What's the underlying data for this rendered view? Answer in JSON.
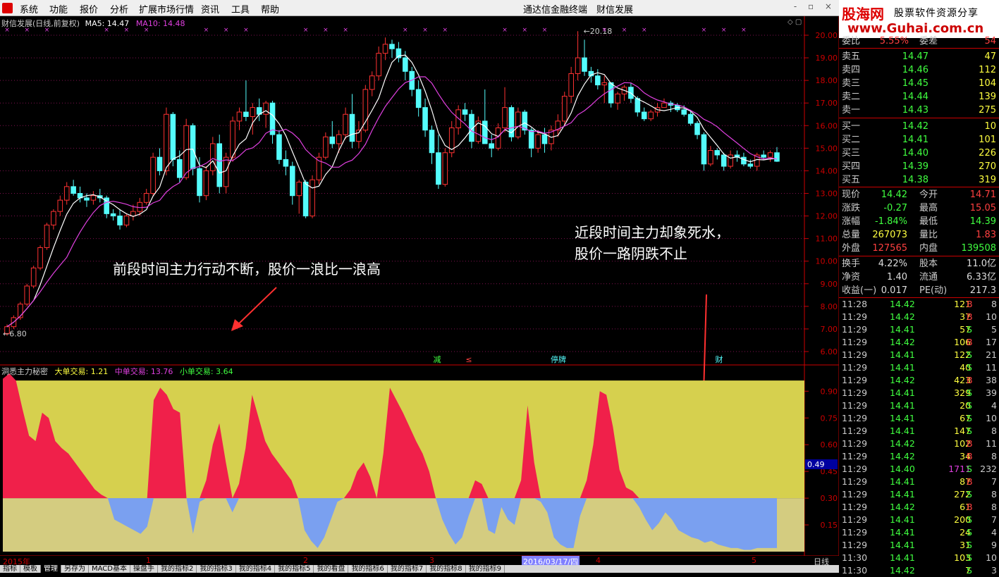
{
  "menu": {
    "items": [
      "系统",
      "功能",
      "报价",
      "分析",
      "扩展市场行情",
      "资讯",
      "工具",
      "帮助"
    ],
    "center": "通达信金融终端　财信发展",
    "controls": "- ▫ ×"
  },
  "brand": {
    "name": "股海网",
    "slogan": "股票软件资源分享",
    "url": "www.Guhai.com.cn"
  },
  "chart_info": {
    "title": "财信发展(日线,前复权)",
    "ma5": "MA5: 14.47",
    "ma10": "MA10: 14.48"
  },
  "toggles": "◇ ▢",
  "annotations": {
    "left": "前段时间主力行动不断，股价一浪比一浪高",
    "right_line1": "近段时间主力却象死水，",
    "right_line2": "股价一路阴跌不止"
  },
  "price_axis": [
    "20.00",
    "19.00",
    "18.00",
    "17.00",
    "16.00",
    "15.00",
    "14.00",
    "13.00",
    "12.00",
    "11.00",
    "10.00",
    "9.00",
    "8.00",
    "7.00",
    "6.00"
  ],
  "price_labels": {
    "high": "20.18",
    "low": "6.80"
  },
  "events": [
    "减",
    "≤",
    "停牌",
    "财"
  ],
  "indicator": {
    "name": "洞悉主力秘密",
    "big": "大单交易: 1.21",
    "mid": "中单交易: 13.76",
    "small": "小单交易: 3.64",
    "axis": [
      "0.90",
      "0.75",
      "0.60",
      "0.45",
      "0.30",
      "0.15"
    ],
    "cursor_value": "0.49"
  },
  "date_axis": {
    "start": "2015年",
    "m1": "1",
    "m2": "2",
    "m3": "3",
    "current": "2016/03/17/四",
    "m4": "4",
    "m5": "5"
  },
  "period_label": "日线",
  "tabs": [
    "指标",
    "模板",
    "管理",
    "另存为",
    "MACD基本",
    "操盘手",
    "我的指标2",
    "我的指标3",
    "我的指标4",
    "我的指标5",
    "我的看盘",
    "我的指标6",
    "我的指标7",
    "我的指标8",
    "我的指标9"
  ],
  "quote": {
    "top": {
      "label": "委比",
      "pct": "5.55%",
      "label2": "委差",
      "val": "54"
    },
    "asks": [
      {
        "label": "卖五",
        "price": "14.47",
        "vol": "47"
      },
      {
        "label": "卖四",
        "price": "14.46",
        "vol": "112"
      },
      {
        "label": "卖三",
        "price": "14.45",
        "vol": "104"
      },
      {
        "label": "卖二",
        "price": "14.44",
        "vol": "139"
      },
      {
        "label": "卖一",
        "price": "14.43",
        "vol": "275"
      }
    ],
    "bids": [
      {
        "label": "买一",
        "price": "14.42",
        "vol": "10"
      },
      {
        "label": "买二",
        "price": "14.41",
        "vol": "101"
      },
      {
        "label": "买三",
        "price": "14.40",
        "vol": "226"
      },
      {
        "label": "买四",
        "price": "14.39",
        "vol": "270"
      },
      {
        "label": "买五",
        "price": "14.38",
        "vol": "319"
      }
    ],
    "stats1": [
      {
        "l": "现价",
        "v": "14.42",
        "l2": "今开",
        "v2": "14.71"
      },
      {
        "l": "涨跌",
        "v": "-0.27",
        "l2": "最高",
        "v2": "15.05"
      },
      {
        "l": "涨幅",
        "v": "-1.84%",
        "l2": "最低",
        "v2": "14.39"
      },
      {
        "l": "总量",
        "v": "267073",
        "l2": "量比",
        "v2": "1.83"
      },
      {
        "l": "外盘",
        "v": "127565",
        "l2": "内盘",
        "v2": "139508"
      }
    ],
    "stats2": [
      {
        "l": "换手",
        "v": "4.22%",
        "l2": "股本",
        "v2": "11.0亿"
      },
      {
        "l": "净资",
        "v": "1.40",
        "l2": "流通",
        "v2": "6.33亿"
      },
      {
        "l": "收益(一)",
        "v": "0.017",
        "l2": "PE(动)",
        "v2": "217.3"
      }
    ],
    "ticks": [
      [
        "11:28",
        "14.42",
        "121",
        "B",
        "8"
      ],
      [
        "11:29",
        "14.42",
        "37",
        "B",
        "10"
      ],
      [
        "11:29",
        "14.41",
        "57",
        "S",
        "5"
      ],
      [
        "11:29",
        "14.42",
        "106",
        "B",
        "17"
      ],
      [
        "11:29",
        "14.41",
        "122",
        "S",
        "21"
      ],
      [
        "11:29",
        "14.41",
        "40",
        "S",
        "11"
      ],
      [
        "11:29",
        "14.42",
        "423",
        "B",
        "38"
      ],
      [
        "11:29",
        "14.41",
        "329",
        "S",
        "39"
      ],
      [
        "11:29",
        "14.41",
        "20",
        "S",
        "4"
      ],
      [
        "11:29",
        "14.41",
        "67",
        "S",
        "10"
      ],
      [
        "11:29",
        "14.41",
        "147",
        "S",
        "8"
      ],
      [
        "11:29",
        "14.42",
        "102",
        "B",
        "11"
      ],
      [
        "11:29",
        "14.42",
        "34",
        "B",
        "8"
      ],
      [
        "11:29",
        "14.40",
        "1711",
        "S",
        "232"
      ],
      [
        "11:29",
        "14.41",
        "87",
        "B",
        "7"
      ],
      [
        "11:29",
        "14.41",
        "272",
        "S",
        "8"
      ],
      [
        "11:29",
        "14.42",
        "61",
        "B",
        "8"
      ],
      [
        "11:29",
        "14.41",
        "200",
        "S",
        "7"
      ],
      [
        "11:29",
        "14.41",
        "24",
        "S",
        "4"
      ],
      [
        "11:29",
        "14.41",
        "31",
        "S",
        "9"
      ],
      [
        "11:30",
        "14.41",
        "103",
        "S",
        "10"
      ],
      [
        "11:30",
        "14.42",
        "7",
        "S",
        "3"
      ]
    ]
  },
  "chart_data": {
    "type": "candlestick",
    "title": "财信发展(日线,前复权)",
    "ylim": [
      6.0,
      20.5
    ],
    "ma_series": [
      {
        "name": "MA5"
      },
      {
        "name": "MA10"
      }
    ],
    "ohlc": [
      [
        6.8,
        7.2,
        6.7,
        7.1
      ],
      [
        7.1,
        7.6,
        7.0,
        7.5
      ],
      [
        7.5,
        8.2,
        7.4,
        8.1
      ],
      [
        8.1,
        9.0,
        8.0,
        8.9
      ],
      [
        8.9,
        9.8,
        8.8,
        9.7
      ],
      [
        9.7,
        10.7,
        9.6,
        10.6
      ],
      [
        10.6,
        11.7,
        10.5,
        11.6
      ],
      [
        11.6,
        12.3,
        11.4,
        12.2
      ],
      [
        12.2,
        12.9,
        12.0,
        12.7
      ],
      [
        12.7,
        13.5,
        12.5,
        13.3
      ],
      [
        13.3,
        13.6,
        12.9,
        13.0
      ],
      [
        13.0,
        13.3,
        12.6,
        12.8
      ],
      [
        12.8,
        13.0,
        12.4,
        12.7
      ],
      [
        12.7,
        13.1,
        12.5,
        12.9
      ],
      [
        12.9,
        13.2,
        12.6,
        12.8
      ],
      [
        12.8,
        12.9,
        11.9,
        12.1
      ],
      [
        12.1,
        12.3,
        11.8,
        12.0
      ],
      [
        12.0,
        12.3,
        11.4,
        11.6
      ],
      [
        11.6,
        12.1,
        11.5,
        12.0
      ],
      [
        12.0,
        12.5,
        11.8,
        12.2
      ],
      [
        12.2,
        12.8,
        12.0,
        12.6
      ],
      [
        12.6,
        13.2,
        12.5,
        13.0
      ],
      [
        13.0,
        14.8,
        12.9,
        14.6
      ],
      [
        14.6,
        15.0,
        13.8,
        14.0
      ],
      [
        14.0,
        16.8,
        13.8,
        16.5
      ],
      [
        16.5,
        16.6,
        14.2,
        14.5
      ],
      [
        14.5,
        14.9,
        13.5,
        13.7
      ],
      [
        13.7,
        16.3,
        13.6,
        16.0
      ],
      [
        16.0,
        16.1,
        13.8,
        14.1
      ],
      [
        14.1,
        14.6,
        12.6,
        12.9
      ],
      [
        12.9,
        14.2,
        12.7,
        14.0
      ],
      [
        14.0,
        15.5,
        13.8,
        15.2
      ],
      [
        15.2,
        15.6,
        13.0,
        13.3
      ],
      [
        13.3,
        14.8,
        13.0,
        14.6
      ],
      [
        14.6,
        16.4,
        14.4,
        16.2
      ],
      [
        16.2,
        16.8,
        15.8,
        16.6
      ],
      [
        16.6,
        18.0,
        16.2,
        16.4
      ],
      [
        16.4,
        17.0,
        15.6,
        16.8
      ],
      [
        16.8,
        17.2,
        16.2,
        16.5
      ],
      [
        16.5,
        17.1,
        15.9,
        17.0
      ],
      [
        17.0,
        17.1,
        15.2,
        15.6
      ],
      [
        15.6,
        15.8,
        14.3,
        14.5
      ],
      [
        14.5,
        14.9,
        13.8,
        14.2
      ],
      [
        14.2,
        14.4,
        12.5,
        12.9
      ],
      [
        12.9,
        13.6,
        12.1,
        13.5
      ],
      [
        13.5,
        13.6,
        11.9,
        12.0
      ],
      [
        12.0,
        13.8,
        11.9,
        13.6
      ],
      [
        13.6,
        14.8,
        13.4,
        14.6
      ],
      [
        14.6,
        15.7,
        14.5,
        15.5
      ],
      [
        15.5,
        16.2,
        15.0,
        15.2
      ],
      [
        15.2,
        15.8,
        14.8,
        15.6
      ],
      [
        15.6,
        16.8,
        15.4,
        16.5
      ],
      [
        16.5,
        17.4,
        15.0,
        15.3
      ],
      [
        15.3,
        16.2,
        15.0,
        15.8
      ],
      [
        15.8,
        17.8,
        15.7,
        17.6
      ],
      [
        17.6,
        18.4,
        17.3,
        18.2
      ],
      [
        18.2,
        19.5,
        18.0,
        19.2
      ],
      [
        19.2,
        19.9,
        18.9,
        19.6
      ],
      [
        19.6,
        19.8,
        19.0,
        19.4
      ],
      [
        19.4,
        19.7,
        18.8,
        19.0
      ],
      [
        19.0,
        19.3,
        18.0,
        18.4
      ],
      [
        18.4,
        18.6,
        17.3,
        17.6
      ],
      [
        17.6,
        18.0,
        16.4,
        16.8
      ],
      [
        16.8,
        17.2,
        15.5,
        15.8
      ],
      [
        15.8,
        16.0,
        14.3,
        14.8
      ],
      [
        14.8,
        15.6,
        13.2,
        13.4
      ],
      [
        13.4,
        15.0,
        13.3,
        14.8
      ],
      [
        14.8,
        16.2,
        14.6,
        15.9
      ],
      [
        15.9,
        16.9,
        15.6,
        16.7
      ],
      [
        16.7,
        17.0,
        16.2,
        16.5
      ],
      [
        16.5,
        16.7,
        15.0,
        15.3
      ],
      [
        15.3,
        16.4,
        15.2,
        16.2
      ],
      [
        16.2,
        17.6,
        15.8,
        15.2
      ],
      [
        15.2,
        15.6,
        14.6,
        15.0
      ],
      [
        15.0,
        16.1,
        14.9,
        15.9
      ],
      [
        15.9,
        17.7,
        15.7,
        16.8
      ],
      [
        16.8,
        16.9,
        15.3,
        15.5
      ],
      [
        15.5,
        16.8,
        15.4,
        16.6
      ],
      [
        16.6,
        16.7,
        15.6,
        15.8
      ],
      [
        15.8,
        15.9,
        14.6,
        15.0
      ],
      [
        15.0,
        15.8,
        14.8,
        15.6
      ],
      [
        15.6,
        15.9,
        14.8,
        15.2
      ],
      [
        15.2,
        16.0,
        14.9,
        15.8
      ],
      [
        15.8,
        16.5,
        15.5,
        16.2
      ],
      [
        16.2,
        17.5,
        16.0,
        17.3
      ],
      [
        17.3,
        18.6,
        17.0,
        18.3
      ],
      [
        18.3,
        20.18,
        18.0,
        19.0
      ],
      [
        19.0,
        19.8,
        18.2,
        18.4
      ],
      [
        18.4,
        18.6,
        17.9,
        18.2
      ],
      [
        18.2,
        18.5,
        17.6,
        17.8
      ],
      [
        17.8,
        18.2,
        17.0,
        17.9
      ],
      [
        17.9,
        17.9,
        16.8,
        17.0
      ],
      [
        17.0,
        17.5,
        16.7,
        17.4
      ],
      [
        17.4,
        17.8,
        17.1,
        17.7
      ],
      [
        17.7,
        17.9,
        17.0,
        17.2
      ],
      [
        17.2,
        17.3,
        16.4,
        16.6
      ],
      [
        16.6,
        16.8,
        16.2,
        16.3
      ],
      [
        16.3,
        16.7,
        16.2,
        16.6
      ],
      [
        16.6,
        17.0,
        16.4,
        16.8
      ],
      [
        16.8,
        17.2,
        16.8,
        17.0
      ],
      [
        17.0,
        17.1,
        16.6,
        16.9
      ],
      [
        16.9,
        17.0,
        16.6,
        16.7
      ],
      [
        16.7,
        16.9,
        16.4,
        16.5
      ],
      [
        16.5,
        16.7,
        16.0,
        16.1
      ],
      [
        16.1,
        16.2,
        15.4,
        15.6
      ],
      [
        15.6,
        15.7,
        14.0,
        14.3
      ],
      [
        14.3,
        15.1,
        14.2,
        14.9
      ],
      [
        14.9,
        15.0,
        14.5,
        14.7
      ],
      [
        14.7,
        14.8,
        14.0,
        14.2
      ],
      [
        14.2,
        14.9,
        14.1,
        14.7
      ],
      [
        14.7,
        14.9,
        14.4,
        14.6
      ],
      [
        14.6,
        14.8,
        14.2,
        14.3
      ],
      [
        14.3,
        14.5,
        14.1,
        14.2
      ],
      [
        14.2,
        14.8,
        14.0,
        14.7
      ],
      [
        14.7,
        14.9,
        14.5,
        14.6
      ],
      [
        14.6,
        14.9,
        14.4,
        14.8
      ],
      [
        14.8,
        15.05,
        14.39,
        14.42
      ]
    ],
    "indicator_series": [
      0.97,
      1.0,
      0.96,
      0.8,
      0.65,
      0.62,
      0.78,
      0.75,
      0.62,
      0.58,
      0.55,
      0.5,
      0.45,
      0.4,
      0.35,
      0.32,
      0.3,
      0.18,
      0.16,
      0.14,
      0.12,
      0.1,
      0.14,
      0.85,
      0.92,
      0.88,
      0.8,
      0.78,
      0.3,
      0.1,
      0.28,
      0.4,
      0.6,
      0.72,
      0.5,
      0.22,
      0.38,
      0.58,
      0.88,
      0.75,
      0.62,
      0.55,
      0.5,
      0.45,
      0.4,
      0.3,
      0.12,
      0.06,
      0.02,
      0.08,
      0.18,
      0.28,
      0.3,
      0.35,
      0.45,
      0.5,
      0.42,
      0.3,
      0.55,
      0.92,
      0.85,
      0.78,
      0.7,
      0.62,
      0.55,
      0.45,
      0.3,
      0.18,
      0.1,
      0.04,
      0.08,
      0.2,
      0.4,
      0.38,
      0.12,
      0.1,
      0.25,
      0.18,
      0.15,
      0.4,
      0.82,
      0.5,
      0.28,
      0.22,
      0.08,
      0.04,
      0.02,
      0.02,
      0.2,
      0.4,
      0.6,
      0.9,
      0.88,
      0.7,
      0.46,
      0.36,
      0.34,
      0.25,
      0.18,
      0.12,
      0.16,
      0.22,
      0.18,
      0.12,
      0.1,
      0.08,
      0.07,
      0.05,
      0.06,
      0.04,
      0.03,
      0.02,
      0.02,
      0.01,
      0.01,
      0.02,
      0.02,
      0.02,
      0.02
    ],
    "indicator_baseline": 0.3
  }
}
